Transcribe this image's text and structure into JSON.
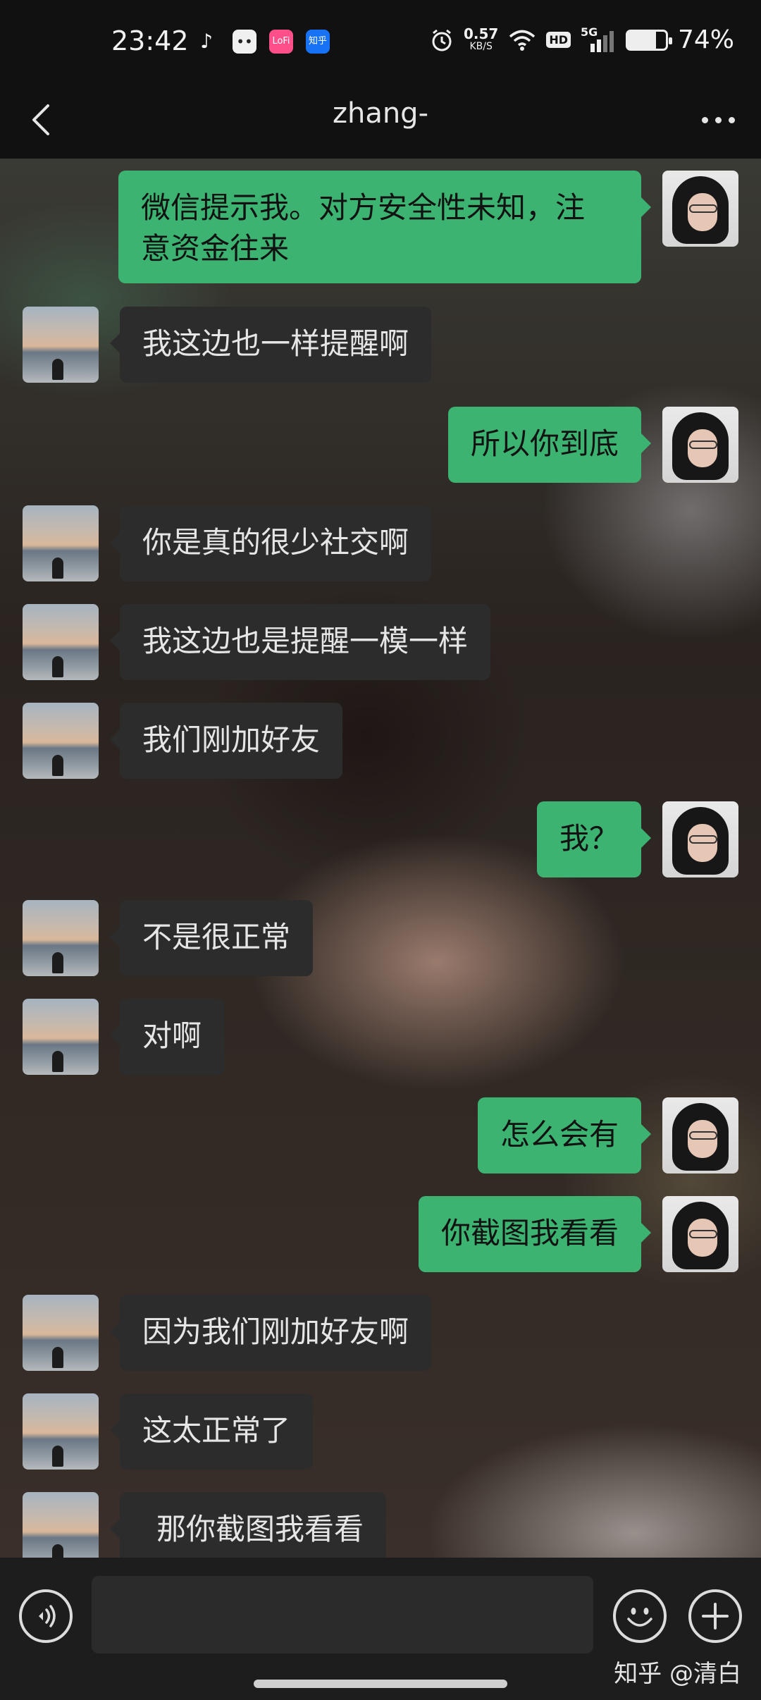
{
  "status_bar": {
    "time": "23:42",
    "app_icons": [
      "tiktok-icon",
      "bilibili-tv-icon",
      "lofter-icon",
      "zhihu-app-icon"
    ],
    "zhihu_badge": "知乎",
    "lofter_badge": "LoFi",
    "net_speed_value": "0.57",
    "net_speed_unit": "KB/S",
    "hd_label": "HD",
    "network_label": "5G",
    "battery_percent_text": "74%",
    "battery_level": 0.74
  },
  "header": {
    "title": "zhang-",
    "back_icon": "chevron-left-icon",
    "more_icon": "more-dots-icon"
  },
  "messages": [
    {
      "side": "right",
      "text": "微信提示我。对方安全性未知，注意资金往来",
      "lines": [
        "微信提示我。对方安全性未知，注",
        "意资金往来"
      ]
    },
    {
      "side": "left",
      "text": "我这边也一样提醒啊"
    },
    {
      "side": "right",
      "text": "所以你到底"
    },
    {
      "side": "left",
      "text": "你是真的很少社交啊"
    },
    {
      "side": "left",
      "text": "我这边也是提醒一模一样"
    },
    {
      "side": "left",
      "text": "我们刚加好友"
    },
    {
      "side": "right",
      "text": "我？"
    },
    {
      "side": "left",
      "text": "不是很正常"
    },
    {
      "side": "left",
      "text": "对啊"
    },
    {
      "side": "right",
      "text": "怎么会有"
    },
    {
      "side": "right",
      "text": "你截图我看看"
    },
    {
      "side": "left",
      "text": "因为我们刚加好友啊"
    },
    {
      "side": "left",
      "text": "这太正常了"
    },
    {
      "side": "left",
      "text": "那你截图我看看"
    }
  ],
  "input_bar": {
    "input_value": "",
    "voice_icon": "voice-icon",
    "emoji_icon": "emoji-icon",
    "plus_icon": "plus-icon"
  },
  "watermark": "知乎 @清白",
  "colors": {
    "sent_bubble": "#3cb371",
    "received_bubble": "#2c2c2c",
    "bar_background": "#111111"
  }
}
